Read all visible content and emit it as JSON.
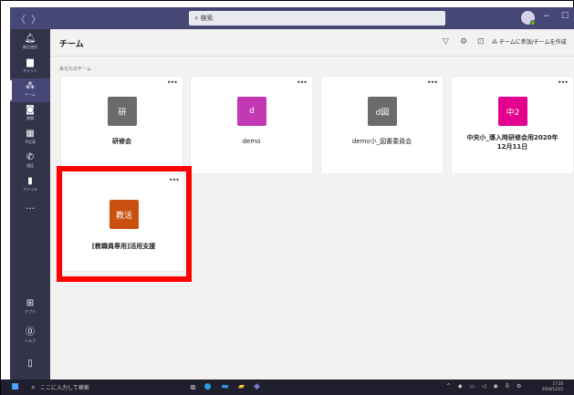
{
  "titlebar": {
    "search_placeholder": "検索",
    "back_glyph": "〈",
    "forward_glyph": "〉"
  },
  "rail": {
    "items": [
      {
        "label": "最近使用",
        "icon": "bell-icon"
      },
      {
        "label": "チャット",
        "icon": "chat-icon"
      },
      {
        "label": "チーム",
        "icon": "teams-icon"
      },
      {
        "label": "課題",
        "icon": "assignments-icon"
      },
      {
        "label": "予定表",
        "icon": "calendar-icon"
      },
      {
        "label": "通話",
        "icon": "phone-icon"
      },
      {
        "label": "ファイル",
        "icon": "file-icon"
      }
    ],
    "more": "…",
    "apps_label": "アプリ",
    "help_label": "ヘルプ"
  },
  "header": {
    "title": "チーム",
    "join_button": "チームに参加/チームを作成"
  },
  "section_label": "あなたのチーム",
  "teams": [
    {
      "tile_text": "研",
      "name": "研修会",
      "color": "#6b6b6b"
    },
    {
      "tile_text": "d",
      "name": "demo",
      "color": "#c239b3"
    },
    {
      "tile_text": "d図",
      "name": "demo小_図書委員会",
      "color": "#6b6b6b"
    },
    {
      "tile_text": "中2",
      "name": "中央小_導入時研修会用2020年12月11日",
      "color": "#e3008c"
    },
    {
      "tile_text": "教活",
      "name": "[教職員専用]活用支援",
      "color": "#ca5010"
    }
  ],
  "taskbar": {
    "search_placeholder": "ここに入力して検索",
    "time": "17:35",
    "date": "2020/12/15"
  },
  "colors": {
    "titlebar": "#464775",
    "rail": "#33344a",
    "highlight": "#ff0000",
    "content_bg": "#f3f2f1"
  }
}
